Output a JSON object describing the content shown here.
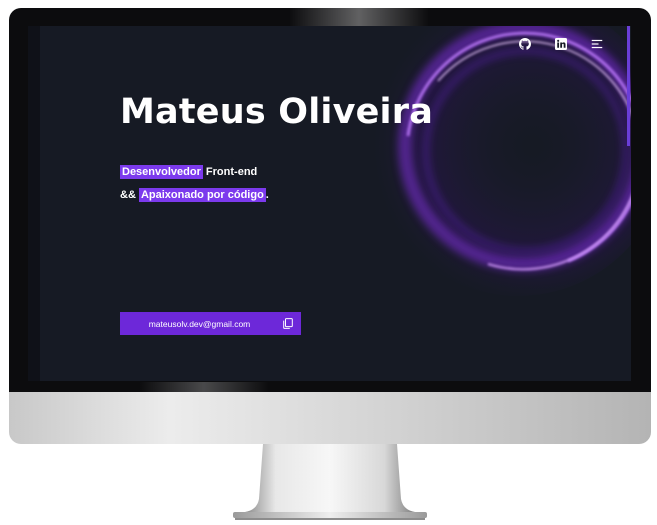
{
  "hero": {
    "name": "Mateus Oliveira",
    "line1_highlight": "Desenvolvedor",
    "line1_rest": " Front-end",
    "line2_prefix": "&& ",
    "line2_highlight": "Apaixonado por código",
    "line2_suffix": "."
  },
  "email_button": {
    "label": "mateusolv.dev@gmail.com"
  },
  "nav": {
    "icons": [
      "github-icon",
      "linkedin-icon",
      "menu-icon"
    ]
  },
  "colors": {
    "accent": "#7c3aed",
    "background": "#161a24",
    "text": "#ffffff"
  }
}
